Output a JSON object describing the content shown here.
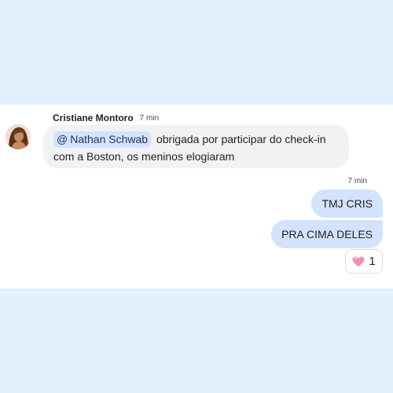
{
  "incoming": {
    "sender_name": "Cristiane Montoro",
    "timestamp": "7 min",
    "mention": "Nathan Schwab",
    "mention_symbol": "@",
    "text_line1": "obrigada por participar do check-in",
    "text_line2": "com a Boston, os meninos elogiaram"
  },
  "outgoing": {
    "timestamp": "7 min",
    "messages": [
      {
        "text": "TMJ CRIS"
      },
      {
        "text": "PRA CIMA DELES"
      }
    ],
    "reaction": {
      "emoji": "pink-heart-icon",
      "count": "1"
    }
  },
  "colors": {
    "page_background": "#e3f0fd",
    "incoming_bubble": "#f2f2f2",
    "outgoing_bubble": "#d3e3fd",
    "mention_chip": "#d3e3fd",
    "heart": "#f48fb1"
  }
}
